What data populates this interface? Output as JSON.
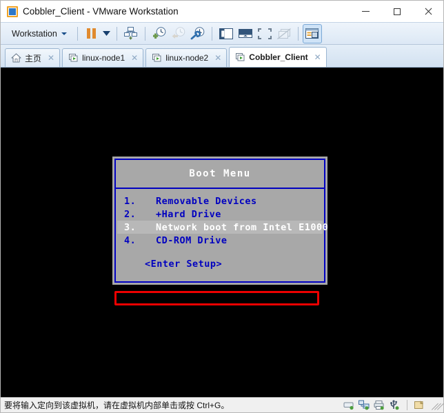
{
  "window": {
    "title": "Cobbler_Client - VMware Workstation",
    "app_icon": "vmware-logo-icon",
    "controls": {
      "minimize": "minimize-icon",
      "maximize": "maximize-icon",
      "close": "close-icon"
    }
  },
  "toolbar": {
    "menu_label": "Workstation",
    "buttons": [
      {
        "name": "pause-vm-button",
        "icon": "pause-icon",
        "title": "Pause",
        "state": "enabled"
      },
      {
        "name": "power-dropdown-button",
        "icon": "chevron-down-icon",
        "title": "Power options",
        "state": "enabled"
      },
      {
        "name": "manage-vm-button",
        "icon": "vm-settings-icon",
        "title": "Manage",
        "state": "enabled"
      },
      {
        "name": "take-snapshot-button",
        "icon": "snapshot-add-icon",
        "title": "Take snapshot",
        "state": "enabled"
      },
      {
        "name": "revert-snapshot-button",
        "icon": "snapshot-revert-icon",
        "title": "Revert to snapshot",
        "state": "disabled"
      },
      {
        "name": "manage-snapshots-button",
        "icon": "snapshot-manage-icon",
        "title": "Manage snapshots",
        "state": "enabled"
      },
      {
        "name": "show-library-button",
        "icon": "library-panel-icon",
        "title": "Show library",
        "state": "enabled"
      },
      {
        "name": "console-view-button",
        "icon": "console-view-icon",
        "title": "Console view",
        "state": "enabled"
      },
      {
        "name": "fullscreen-button",
        "icon": "fullscreen-icon",
        "title": "Enter full screen",
        "state": "enabled"
      },
      {
        "name": "unity-mode-button",
        "icon": "unity-mode-disabled-icon",
        "title": "Unity mode",
        "state": "disabled"
      },
      {
        "name": "show-thumbnails-button",
        "icon": "thumbnail-bar-icon",
        "title": "Show thumbnails",
        "state": "pressed"
      }
    ]
  },
  "tabs": [
    {
      "label": "主页",
      "icon": "home-icon",
      "active": false,
      "close": "✕"
    },
    {
      "label": "linux-node1",
      "icon": "vm-tab-icon",
      "active": false,
      "close": "✕"
    },
    {
      "label": "linux-node2",
      "icon": "vm-tab-icon",
      "active": false,
      "close": "✕"
    },
    {
      "label": "Cobbler_Client",
      "icon": "vm-tab-icon",
      "active": true,
      "close": "✕"
    }
  ],
  "boot_menu": {
    "title": "Boot Menu",
    "items": [
      {
        "num": "1.",
        "label": "Removable Devices",
        "selected": false
      },
      {
        "num": "2.",
        "label": "+Hard Drive",
        "selected": false
      },
      {
        "num": "3.",
        "label": "Network boot from Intel E1000",
        "selected": true
      },
      {
        "num": "4.",
        "label": "CD-ROM Drive",
        "selected": false
      }
    ],
    "setup_label": "<Enter Setup>",
    "colors": {
      "background": "#a8a8a8",
      "border": "#0000c0",
      "text": "#0000c0",
      "title_text": "#ffffff",
      "selected_bg": "#b8b8b8",
      "selected_text": "#ffffff",
      "annotation": "#ee0000"
    }
  },
  "statusbar": {
    "message": "要将输入定向到该虚拟机，请在虚拟机内部单击或按 Ctrl+G。",
    "icons": [
      {
        "name": "hard-disk-status-icon"
      },
      {
        "name": "network-adapter-status-icon"
      },
      {
        "name": "printer-status-icon"
      },
      {
        "name": "usb-status-icon"
      },
      {
        "name": "removable-device-status-icon"
      }
    ]
  }
}
